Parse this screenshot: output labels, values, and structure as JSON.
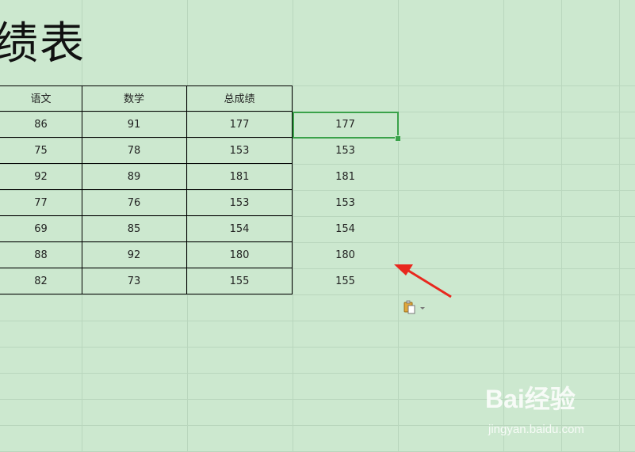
{
  "sheet": {
    "title_fragment": "绩表",
    "headers": [
      "语文",
      "数学",
      "总成绩"
    ],
    "rows": [
      [
        "86",
        "91",
        "177"
      ],
      [
        "75",
        "78",
        "153"
      ],
      [
        "92",
        "89",
        "181"
      ],
      [
        "77",
        "76",
        "153"
      ],
      [
        "69",
        "85",
        "154"
      ],
      [
        "88",
        "92",
        "180"
      ],
      [
        "82",
        "73",
        "155"
      ]
    ],
    "pasted_column": [
      "177",
      "153",
      "181",
      "153",
      "154",
      "180",
      "155"
    ]
  },
  "colors": {
    "background": "#cce8cf",
    "selection": "#3aa24a",
    "arrow": "#e8281e"
  },
  "icons": {
    "paste_options": "paste-options-icon",
    "dropdown": "chevron-down-icon"
  },
  "watermark": {
    "brand": "Bai经验",
    "url": "jingyan.baidu.com"
  }
}
